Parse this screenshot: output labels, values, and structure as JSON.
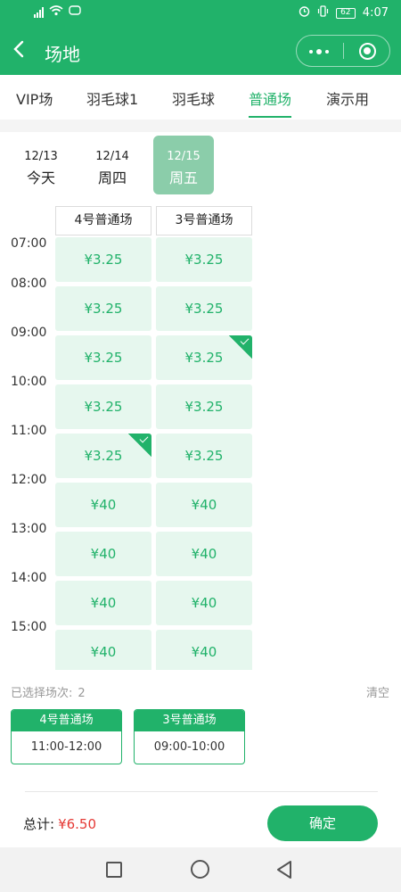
{
  "status_bar": {
    "battery": "62",
    "time": "4:07"
  },
  "header": {
    "title": "场地"
  },
  "tabs": [
    {
      "label": "VIP场",
      "active": false
    },
    {
      "label": "羽毛球1",
      "active": false
    },
    {
      "label": "羽毛球",
      "active": false
    },
    {
      "label": "普通场",
      "active": true
    },
    {
      "label": "演示用",
      "active": false
    }
  ],
  "dates": [
    {
      "date": "12/13",
      "weekday": "今天",
      "selected": false
    },
    {
      "date": "12/14",
      "weekday": "周四",
      "selected": false
    },
    {
      "date": "12/15",
      "weekday": "周五",
      "selected": true
    }
  ],
  "courts": [
    "4号普通场",
    "3号普通场"
  ],
  "times": [
    "07:00",
    "08:00",
    "09:00",
    "10:00",
    "11:00",
    "12:00",
    "13:00",
    "14:00",
    "15:00"
  ],
  "slots": {
    "court_4": [
      {
        "price": "¥3.25",
        "selected": false
      },
      {
        "price": "¥3.25",
        "selected": false
      },
      {
        "price": "¥3.25",
        "selected": false
      },
      {
        "price": "¥3.25",
        "selected": false
      },
      {
        "price": "¥3.25",
        "selected": true
      },
      {
        "price": "¥40",
        "selected": false
      },
      {
        "price": "¥40",
        "selected": false
      },
      {
        "price": "¥40",
        "selected": false
      },
      {
        "price": "¥40",
        "selected": false
      }
    ],
    "court_3": [
      {
        "price": "¥3.25",
        "selected": false
      },
      {
        "price": "¥3.25",
        "selected": false
      },
      {
        "price": "¥3.25",
        "selected": true
      },
      {
        "price": "¥3.25",
        "selected": false
      },
      {
        "price": "¥3.25",
        "selected": false
      },
      {
        "price": "¥40",
        "selected": false
      },
      {
        "price": "¥40",
        "selected": false
      },
      {
        "price": "¥40",
        "selected": false
      },
      {
        "price": "¥40",
        "selected": false
      }
    ]
  },
  "selection": {
    "label": "已选择场次:",
    "count": "2",
    "clear_label": "清空",
    "items": [
      {
        "court": "4号普通场",
        "time": "11:00-12:00"
      },
      {
        "court": "3号普通场",
        "time": "09:00-10:00"
      }
    ]
  },
  "footer": {
    "total_label": "总计:",
    "total_value": "¥6.50",
    "confirm_label": "确定"
  },
  "colors": {
    "brand": "#21b26a",
    "slot_bg": "#e6f7ee",
    "date_selected": "#8bcdaa",
    "price_red": "#e53935"
  }
}
